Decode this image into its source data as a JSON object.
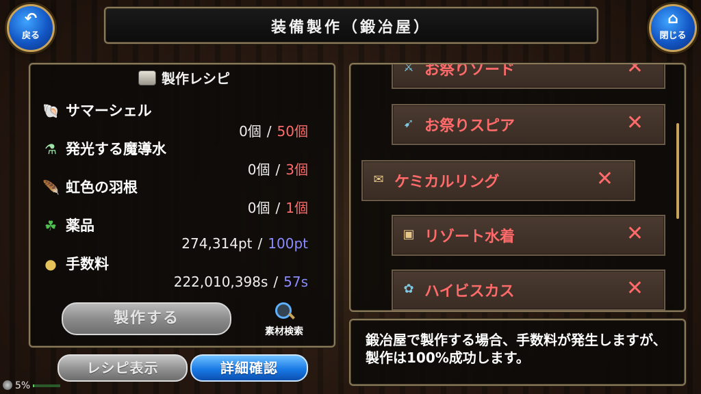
{
  "header": {
    "title": "装備製作（鍛冶屋）",
    "back_label": "戻る",
    "close_label": "閉じる"
  },
  "recipe": {
    "title": "製作レシピ",
    "materials": [
      {
        "icon": "shell-icon",
        "glyph": "🐚",
        "name": "サマーシェル",
        "have": "0個",
        "need": "50個",
        "need_color": "red"
      },
      {
        "icon": "potion-icon",
        "glyph": "⚗",
        "name": "発光する魔導水",
        "have": "0個",
        "need": "3個",
        "need_color": "red"
      },
      {
        "icon": "feather-icon",
        "glyph": "🪶",
        "name": "虹色の羽根",
        "have": "0個",
        "need": "1個",
        "need_color": "red"
      },
      {
        "icon": "herb-icon",
        "glyph": "☘",
        "name": "薬品",
        "have": "274,314pt",
        "need": "100pt",
        "need_color": "blue"
      },
      {
        "icon": "coin-icon",
        "glyph": "●",
        "name": "手数料",
        "have": "222,010,398s",
        "need": "57s",
        "need_color": "blue"
      }
    ],
    "separator": "/",
    "make_label": "製作する",
    "search_label": "素材検索"
  },
  "bottom_buttons": {
    "recipe_view": "レシピ表示",
    "detail_check": "詳細確認"
  },
  "list": {
    "items": [
      {
        "name": "お祭りソード",
        "icon": "sword-icon",
        "mark": "✕"
      },
      {
        "name": "お祭りスピア",
        "icon": "spear-icon",
        "mark": "✕"
      },
      {
        "name": "ケミカルリング",
        "icon": "scroll-icon",
        "mark": "✕"
      },
      {
        "name": "リゾート水着",
        "icon": "swimsuit-icon",
        "mark": "✕"
      },
      {
        "name": "ハイビスカス",
        "icon": "flower-icon",
        "mark": "✕"
      }
    ]
  },
  "message": "鍛冶屋で製作する場合、手数料が発生しますが、製作は100%成功します。",
  "status": {
    "percent": "5%",
    "progress": 0.05
  },
  "colors": {
    "need_red": "#ff6b6b",
    "need_blue": "#8a8cff",
    "accent_gold": "#c9a35a",
    "button_blue": "#1a7ae6"
  }
}
